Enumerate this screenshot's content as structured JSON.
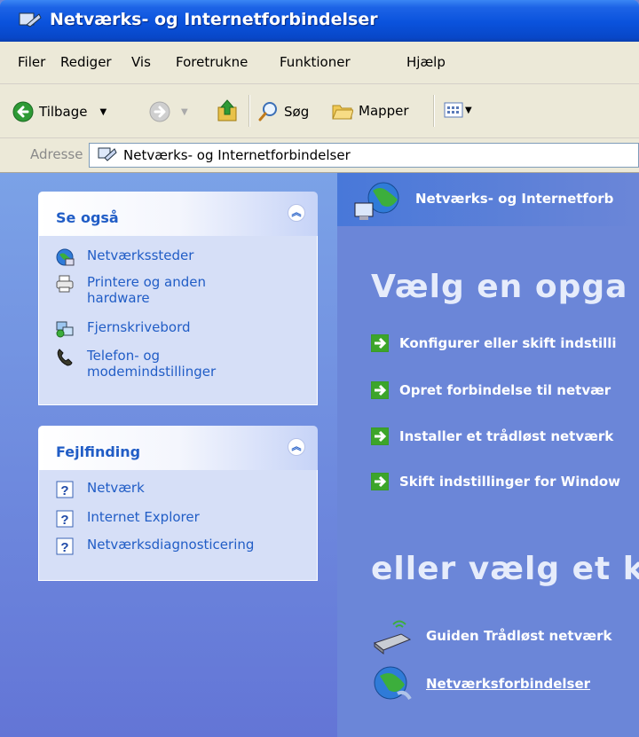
{
  "window": {
    "title": "Netværks- og Internetforbindelser"
  },
  "menu": [
    "Filer",
    "Rediger",
    "Vis",
    "Foretrukne",
    "Funktioner",
    "Hjælp"
  ],
  "toolbar": {
    "back_label": "Tilbage",
    "search_label": "Søg",
    "folders_label": "Mapper"
  },
  "address": {
    "label": "Adresse",
    "value": "Netværks- og Internetforbindelser"
  },
  "left": {
    "see_also": {
      "title": "Se også",
      "items": [
        {
          "label": "Netværkssteder",
          "icon": "network-places-icon"
        },
        {
          "label": "Printere og anden hardware",
          "icon": "printer-icon"
        },
        {
          "label": "Fjernskrivebord",
          "icon": "remote-desktop-icon"
        },
        {
          "label": "Telefon- og modemindstillinger",
          "icon": "phone-icon"
        }
      ]
    },
    "troubleshooting": {
      "title": "Fejlfinding",
      "items": [
        {
          "label": "Netværk",
          "icon": "help-icon"
        },
        {
          "label": "Internet Explorer",
          "icon": "help-icon"
        },
        {
          "label": "Netværksdiagnosticering",
          "icon": "help-icon"
        }
      ]
    }
  },
  "right": {
    "header": "Netværks- og Internetforb",
    "choose_task": "Vælg en opga",
    "tasks": [
      "Konfigurer eller skift indstilli",
      "Opret forbindelse til netvær",
      "Installer et trådløst netværk",
      "Skift indstillinger for Window"
    ],
    "or_choose": "eller vælg et k",
    "icons": [
      {
        "label": "Guiden Trådløst netværk",
        "icon": "wireless-wizard-icon"
      },
      {
        "label": "Netværksforbindelser",
        "icon": "network-connections-icon"
      }
    ]
  },
  "colors": {
    "link": "#215dc6",
    "title_bar": "#0a52dc",
    "pane": "#6b86d8"
  }
}
